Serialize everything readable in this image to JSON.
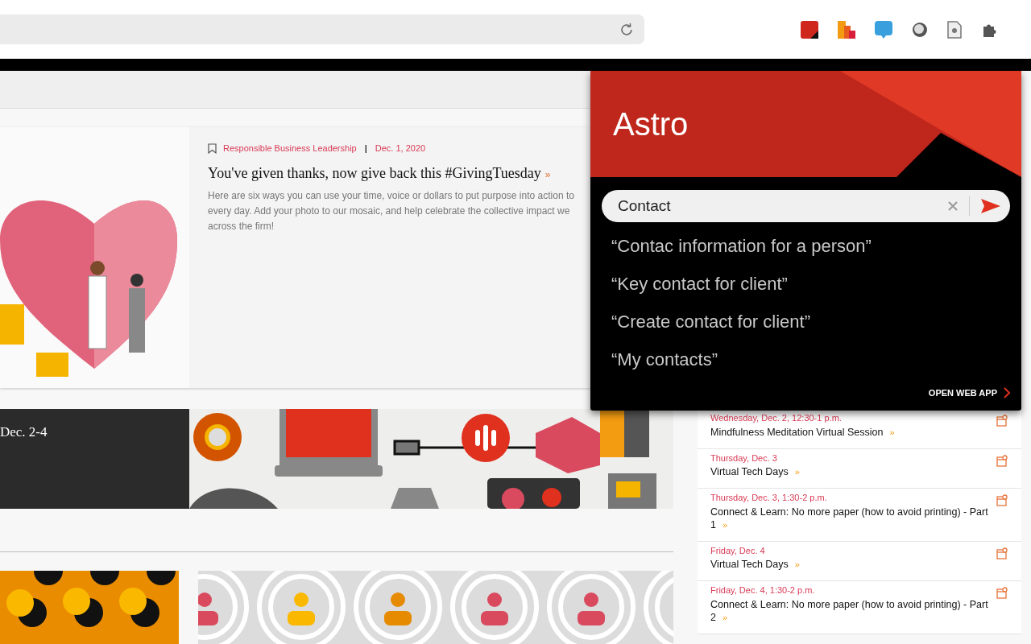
{
  "article": {
    "category": "Responsible Business Leadership",
    "separator": "|",
    "date": "Dec. 1, 2020",
    "headline": "You've given thanks, now give back this #GivingTuesday",
    "headline_arrow": "»",
    "summary_lines": [
      "Here are six ways you can use your time, voice or dollars to put purpose into action to",
      "every day. Add your photo to our mosaic, and help celebrate the collective impact we",
      "across the firm!"
    ]
  },
  "banner": {
    "date": "Dec. 2-4"
  },
  "assistant": {
    "title": "Astro",
    "search": {
      "value": "Contact"
    },
    "suggestions": [
      "“Contac information for a person”",
      "“Key contact for client”",
      "“Create contact for client”",
      "“My contacts”"
    ],
    "open_link": "OPEN WEB APP"
  },
  "events": [
    {
      "date": "Wednesday, Dec. 2, 12:30-1 p.m.",
      "title": "Mindfulness Meditation Virtual Session",
      "arrow": "»"
    },
    {
      "date": "Thursday, Dec. 3",
      "title": "Virtual Tech Days",
      "arrow": "»"
    },
    {
      "date": "Thursday, Dec. 3, 1:30-2 p.m.",
      "title": "Connect & Learn: No more paper (how to avoid printing) - Part 1",
      "arrow": "»"
    },
    {
      "date": "Friday, Dec. 4",
      "title": "Virtual Tech Days",
      "arrow": "»"
    },
    {
      "date": "Friday, Dec. 4, 1:30-2 p.m.",
      "title": "Connect & Learn: No more paper (how to avoid printing) - Part 2",
      "arrow": "»"
    }
  ]
}
